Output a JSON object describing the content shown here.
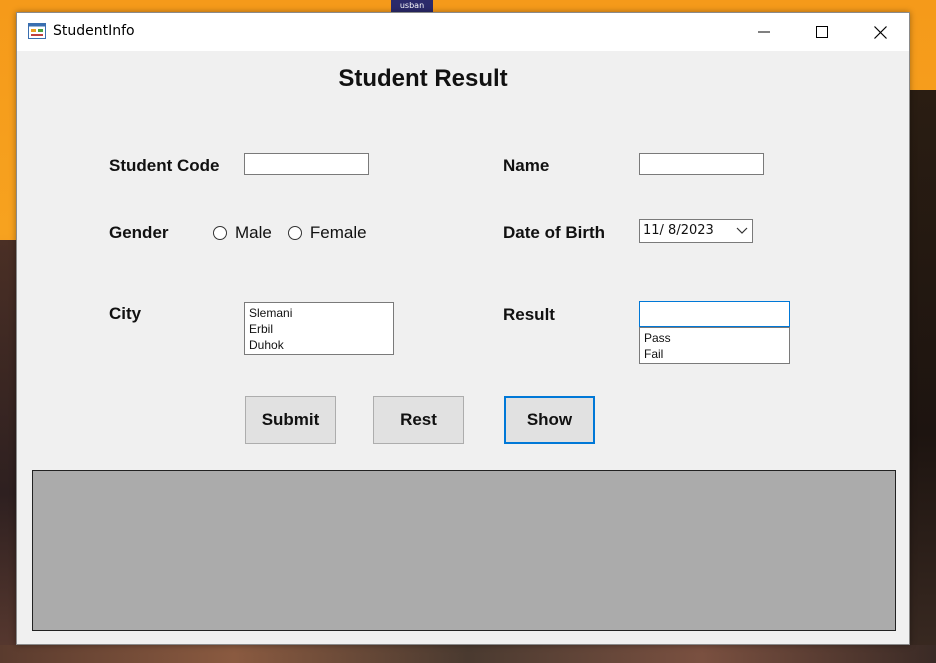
{
  "window": {
    "title": "StudentInfo",
    "taskbar_thumb": "usban"
  },
  "page": {
    "title": "Student Result"
  },
  "form": {
    "student_code_label": "Student Code",
    "student_code_value": "",
    "name_label": "Name",
    "name_value": "",
    "gender_label": "Gender",
    "gender_options": [
      "Male",
      "Female"
    ],
    "gender_selected": "",
    "dob_label": "Date of Birth",
    "dob_value": "11/  8/2023",
    "city_label": "City",
    "city_options": [
      "Slemani",
      "Erbil",
      "Duhok"
    ],
    "result_label": "Result",
    "result_value": "",
    "result_options": [
      "Pass",
      "Fail"
    ]
  },
  "buttons": {
    "submit": "Submit",
    "reset": "Rest",
    "show": "Show"
  },
  "colors": {
    "focus_accent": "#0078d7",
    "window_bg": "#f0f0f0",
    "grid_bg": "#ababab"
  }
}
